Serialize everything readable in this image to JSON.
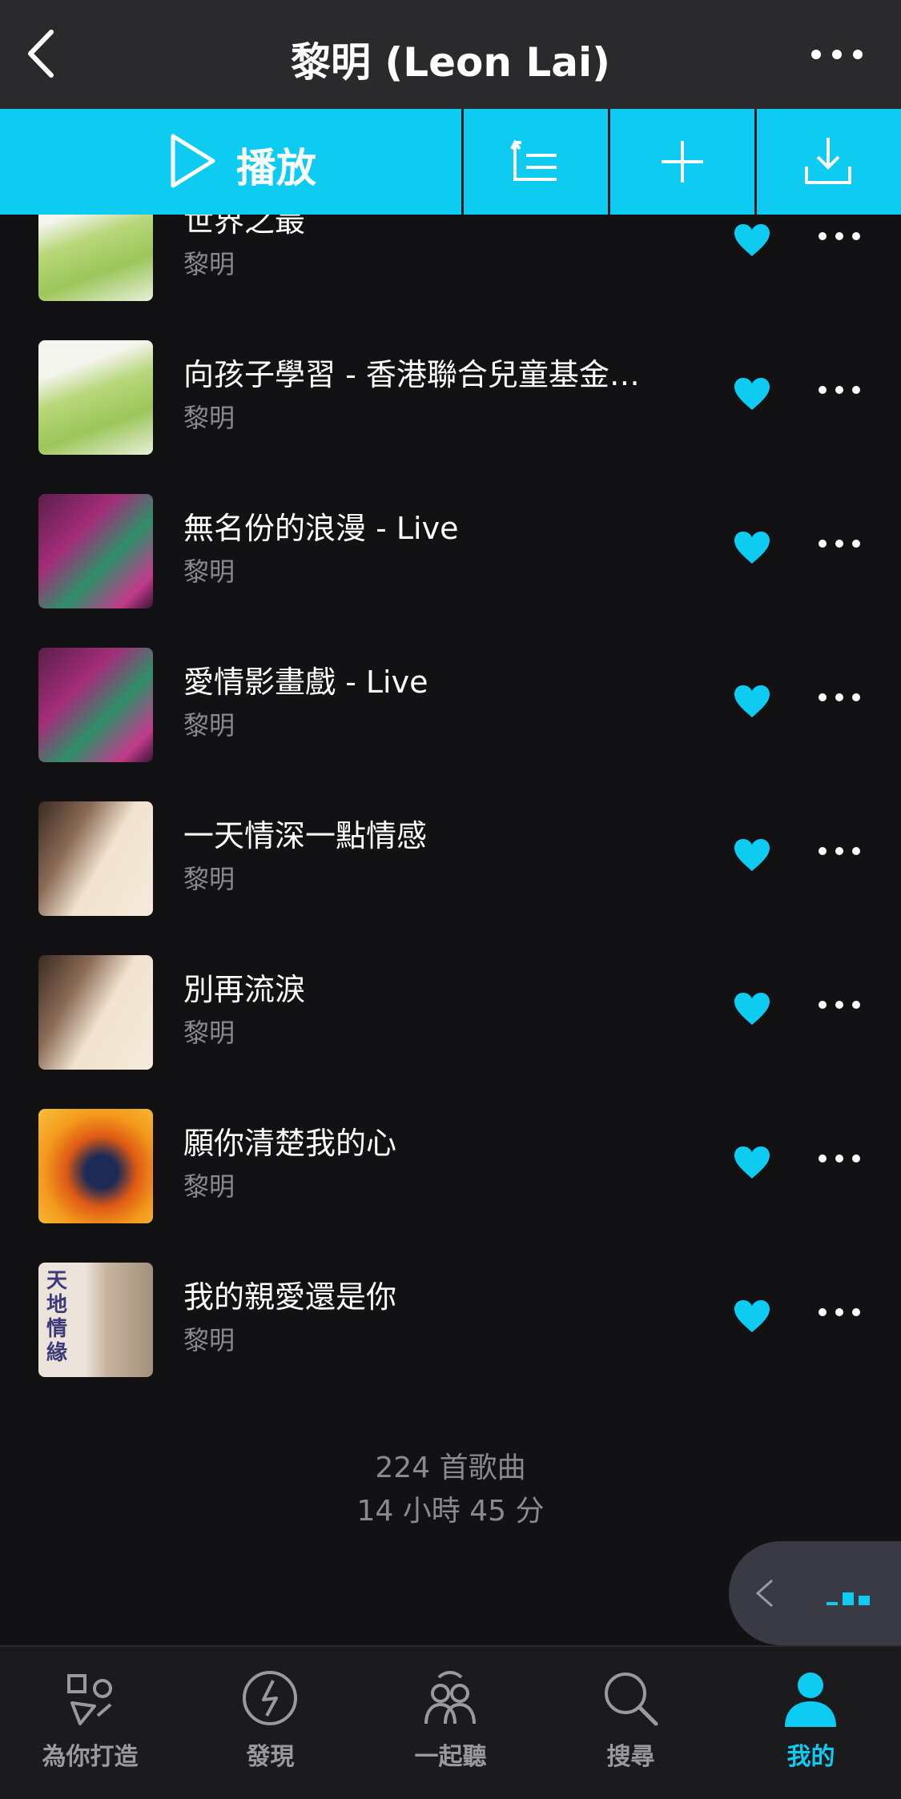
{
  "header": {
    "title": "黎明 (Leon Lai)"
  },
  "action_bar": {
    "play_label": "播放"
  },
  "songs": [
    {
      "title": "世界之最",
      "artist": "黎明"
    },
    {
      "title": "向孩子學習 - 香港聯合兒童基金…",
      "artist": "黎明"
    },
    {
      "title": "無名份的浪漫 - Live",
      "artist": "黎明"
    },
    {
      "title": "愛情影畫戲 - Live",
      "artist": "黎明"
    },
    {
      "title": "一天情深一點情感",
      "artist": "黎明"
    },
    {
      "title": "別再流淚",
      "artist": "黎明"
    },
    {
      "title": "願你清楚我的心",
      "artist": "黎明"
    },
    {
      "title": "我的親愛還是你",
      "artist": "黎明"
    }
  ],
  "cover_art_text": {
    "cover_8": "天地情緣"
  },
  "summary": {
    "count": "224 首歌曲",
    "duration": "14 小時 45 分"
  },
  "tabs": [
    {
      "label": "為你打造"
    },
    {
      "label": "發現"
    },
    {
      "label": "一起聽"
    },
    {
      "label": "搜尋"
    },
    {
      "label": "我的"
    }
  ],
  "colors": {
    "accent": "#0ecbf1",
    "background": "#121214",
    "header": "#2a2a2c",
    "muted_text": "#8a8a8e"
  }
}
